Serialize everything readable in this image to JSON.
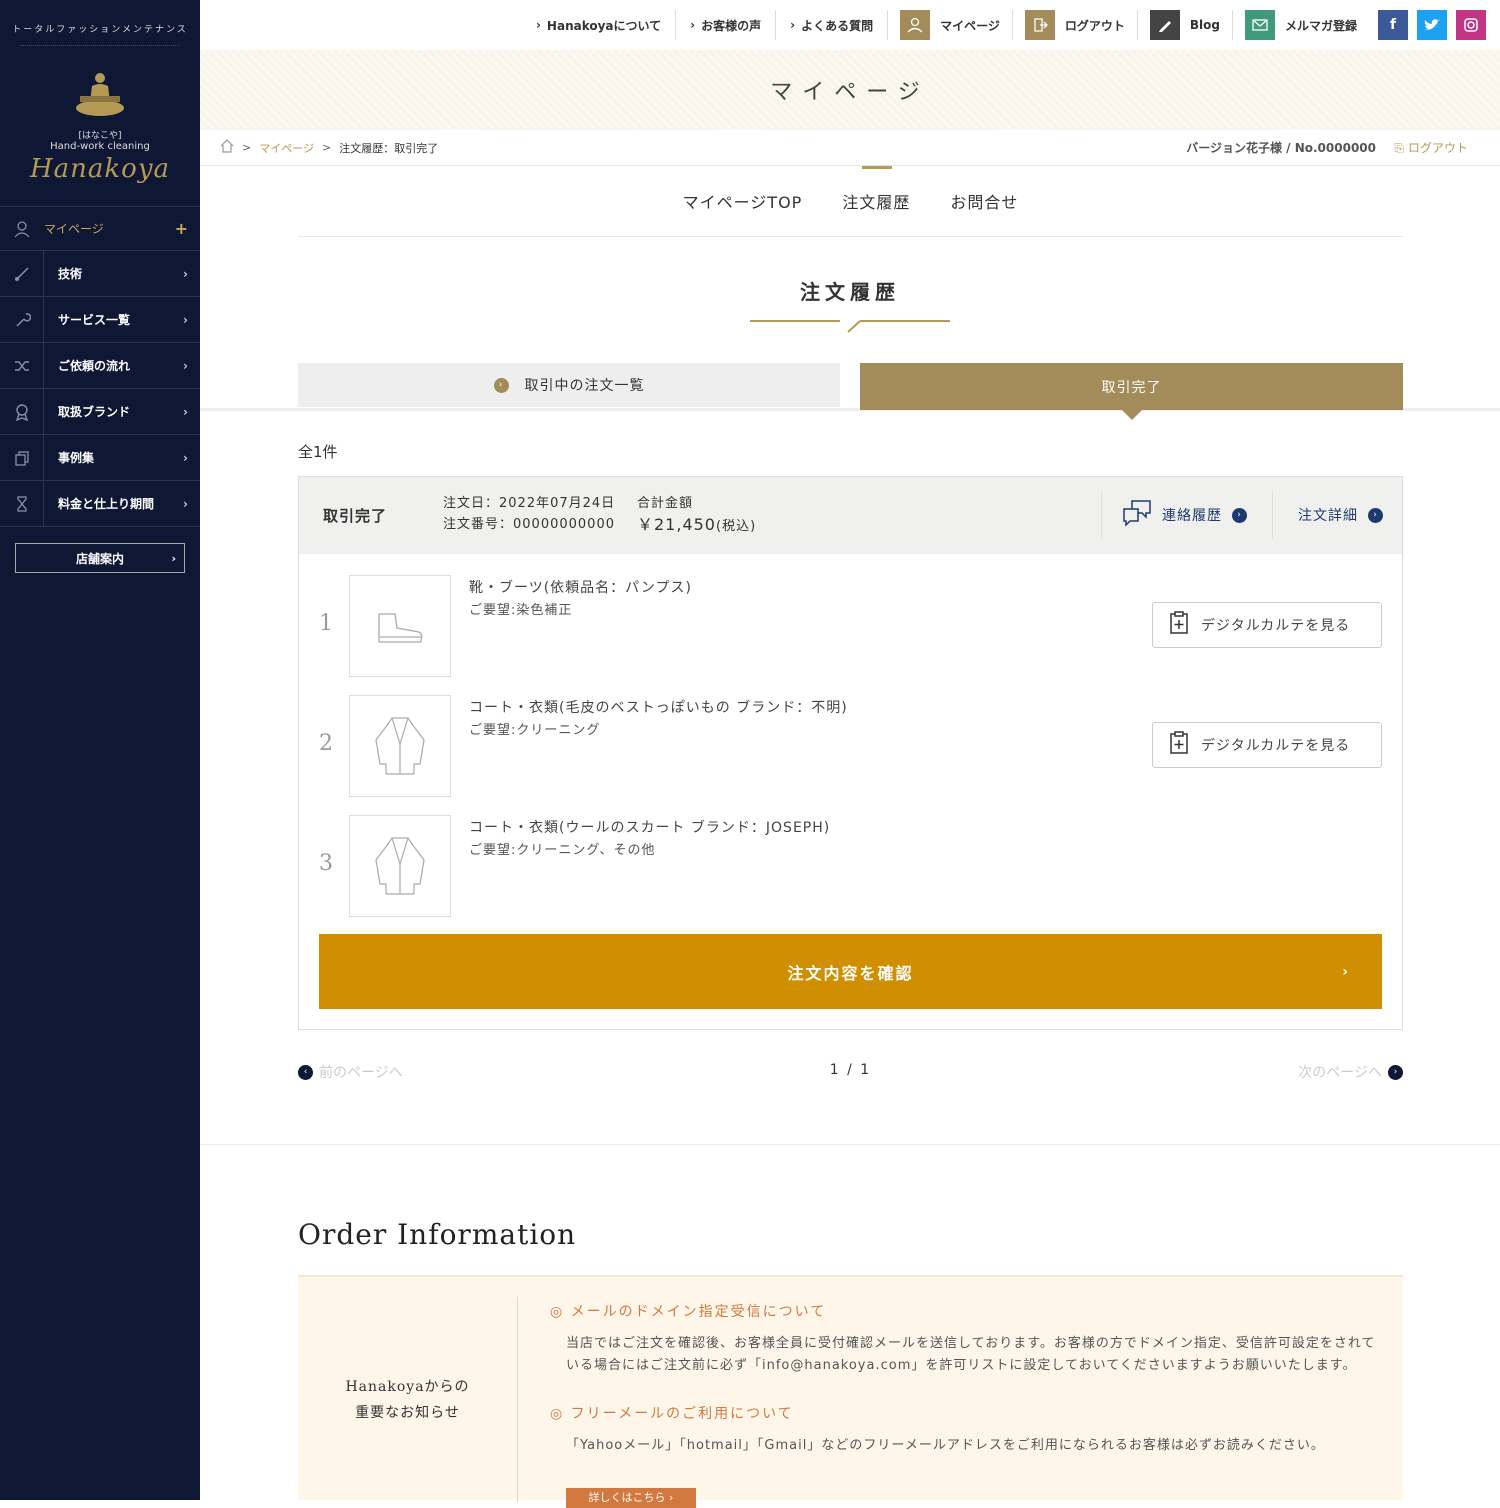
{
  "sidebar": {
    "tagline": "トータルファッションメンテナンス",
    "logo_kana": "[はなこや]",
    "logo_sub": "Hand-work cleaning",
    "logo_brand": "Hanakoya",
    "items": [
      {
        "label": "マイページ",
        "icon": "user-icon"
      },
      {
        "label": "技術",
        "icon": "brush-icon"
      },
      {
        "label": "サービス一覧",
        "icon": "wrench-icon"
      },
      {
        "label": "ご依頼の流れ",
        "icon": "shuffle-icon"
      },
      {
        "label": "取扱ブランド",
        "icon": "award-icon"
      },
      {
        "label": "事例集",
        "icon": "copy-icon"
      },
      {
        "label": "料金と仕上り期間",
        "icon": "hourglass-icon"
      }
    ],
    "store_label": "店舗案内"
  },
  "topbar": {
    "links": [
      "Hanakoyaについて",
      "お客様の声",
      "よくある質問"
    ],
    "mypage": "マイページ",
    "logout": "ログアウト",
    "blog": "Blog",
    "newsletter": "メルマガ登録",
    "colors": {
      "mypage": "#a38c59",
      "logout": "#a38c59",
      "blog": "#444444",
      "newsletter": "#3f9a7b",
      "facebook": "#3b5998",
      "twitter": "#1da1f2",
      "instagram": "#c13584"
    }
  },
  "hero_title": "マイページ",
  "breadcrumb": {
    "items": [
      "マイページ",
      "注文履歴：取引完了"
    ],
    "user": "バージョン花子様 / No.0000000",
    "logout": "ログアウト"
  },
  "subnav": [
    "マイページTOP",
    "注文履歴",
    "お問合せ"
  ],
  "section_title": "注文履歴",
  "tabs": {
    "active_orders": "取引中の注文一覧",
    "completed": "取引完了"
  },
  "count_label": "全1件",
  "order": {
    "status": "取引完了",
    "date_line": "注文日：2022年07月24日",
    "number_line": "注文番号：00000000000",
    "total_label": "合計金額",
    "total_amount": "￥21,450",
    "total_tax": "(税込)",
    "contact_history": "連絡履歴",
    "order_detail": "注文詳細",
    "items": [
      {
        "no": "1",
        "name": "靴・ブーツ(依頼品名：パンプス)",
        "request": "ご要望:染色補正",
        "karte": "デジタルカルテを見る",
        "icon": "boot-icon"
      },
      {
        "no": "2",
        "name": "コート・衣類(毛皮のベストっぽいもの ブランド：不明)",
        "request": "ご要望:クリーニング",
        "karte": "デジタルカルテを見る",
        "icon": "coat-icon"
      },
      {
        "no": "3",
        "name": "コート・衣類(ウールのスカート ブランド：JOSEPH)",
        "request": "ご要望:クリーニング、その他",
        "karte": "",
        "icon": "coat-icon"
      }
    ],
    "confirm_label": "注文内容を確認"
  },
  "pager": {
    "prev": "前のページへ",
    "current": "1 / 1",
    "next": "次のページへ"
  },
  "order_info": {
    "title": "Order Information",
    "left_line1": "Hanakoyaからの",
    "left_line2": "重要なお知らせ",
    "notices": [
      {
        "heading": "◎ メールのドメイン指定受信について",
        "body": "当店ではご注文を確認後、お客様全員に受付確認メールを送信しております。お客様の方でドメイン指定、受信許可設定をされている場合にはご注文前に必ず「info@hanakoya.com」を許可リストに設定しておいてくださいますようお願いいたします。"
      },
      {
        "heading": "◎ フリーメールのご利用について",
        "body": "「Yahooメール」「hotmail」「Gmail」などのフリーメールアドレスをご利用になられるお客様は必ずお読みください。"
      }
    ],
    "more_label": "詳しくはこちら ›"
  }
}
